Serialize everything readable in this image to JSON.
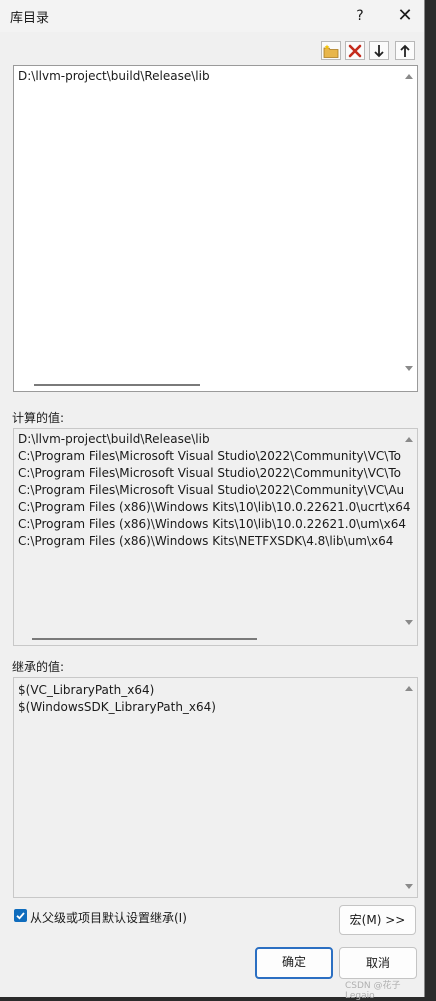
{
  "dialog": {
    "title": "库目录",
    "help": "?",
    "close": "✕"
  },
  "directories_list": {
    "items": [
      "D:\\llvm-project\\build\\Release\\lib"
    ]
  },
  "evaluated": {
    "label": "计算的值:",
    "items": [
      "D:\\llvm-project\\build\\Release\\lib",
      "C:\\Program Files\\Microsoft Visual Studio\\2022\\Community\\VC\\To",
      "C:\\Program Files\\Microsoft Visual Studio\\2022\\Community\\VC\\To",
      "C:\\Program Files\\Microsoft Visual Studio\\2022\\Community\\VC\\Au",
      "C:\\Program Files (x86)\\Windows Kits\\10\\lib\\10.0.22621.0\\ucrt\\x64",
      "C:\\Program Files (x86)\\Windows Kits\\10\\lib\\10.0.22621.0\\um\\x64",
      "C:\\Program Files (x86)\\Windows Kits\\NETFXSDK\\4.8\\lib\\um\\x64"
    ]
  },
  "inherited": {
    "label": "继承的值:",
    "items": [
      "$(VC_LibraryPath_x64)",
      "$(WindowsSDK_LibraryPath_x64)"
    ]
  },
  "inherit_checkbox": {
    "label": "从父级或项目默认设置继承(I)",
    "checked": true
  },
  "buttons": {
    "macro": "宏(M) >>",
    "ok": "确定",
    "cancel": "取消"
  },
  "watermark": "CSDN @花子Legaio",
  "colors": {
    "accent": "#0f6cbd",
    "delete_red": "#c42b1c"
  }
}
